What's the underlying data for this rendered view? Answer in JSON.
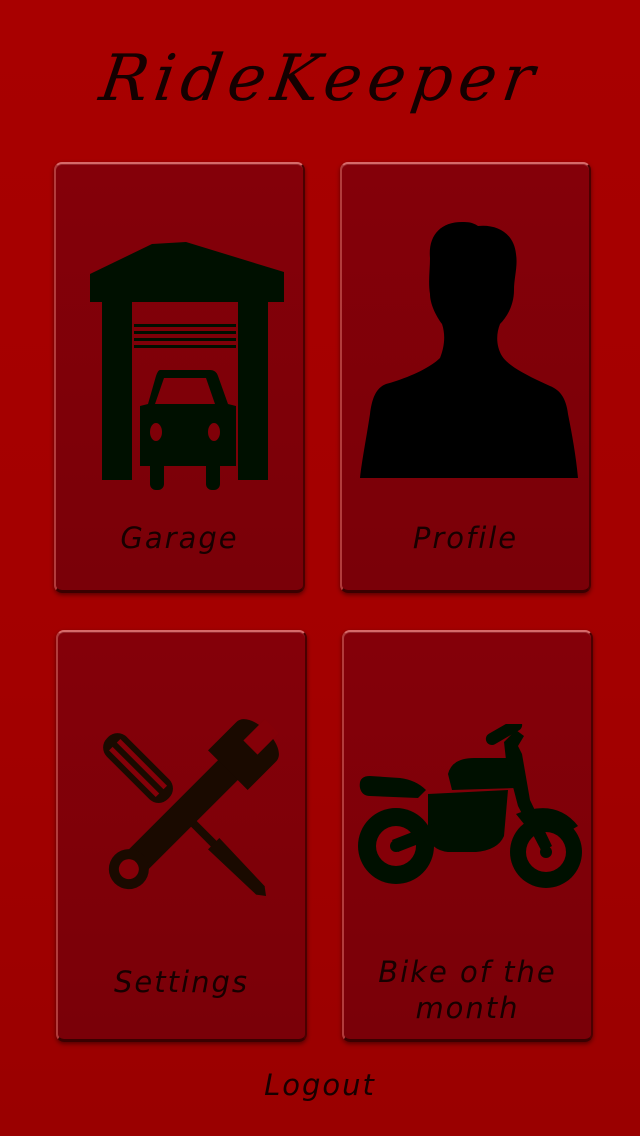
{
  "app": {
    "title": "RideKeeper"
  },
  "tiles": {
    "garage": {
      "label": "Garage",
      "icon": "garage-icon"
    },
    "profile": {
      "label": "Profile",
      "icon": "person-silhouette-icon"
    },
    "settings": {
      "label": "Settings",
      "icon": "wrench-screwdriver-icon"
    },
    "bike": {
      "label_line1": "Bike of the",
      "label_line2": "month",
      "icon": "motorcycle-icon"
    }
  },
  "footer": {
    "logout_label": "Logout"
  },
  "colors": {
    "background": "#a80000",
    "tile": "#820008",
    "icon": "#001000",
    "text": "#170000"
  }
}
